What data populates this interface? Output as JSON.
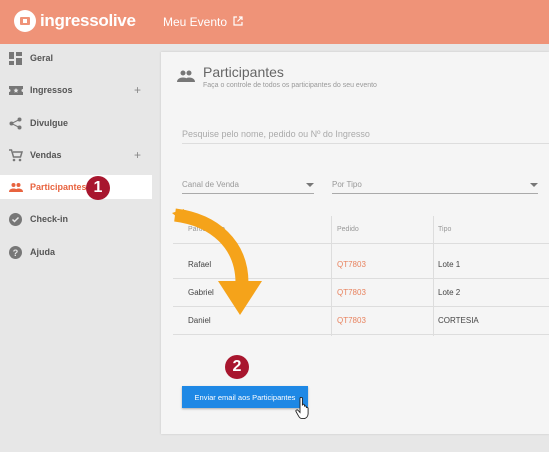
{
  "header": {
    "brand": "ingressolive",
    "event_link": "Meu Evento",
    "bg_color": "#ef9378"
  },
  "sidebar": {
    "items": [
      {
        "label": "Geral",
        "icon": "dashboard-icon",
        "expandable": false
      },
      {
        "label": "Ingressos",
        "icon": "ticket-icon",
        "expandable": true
      },
      {
        "label": "Divulgue",
        "icon": "share-icon",
        "expandable": false
      },
      {
        "label": "Vendas",
        "icon": "cart-icon",
        "expandable": true
      },
      {
        "label": "Participantes",
        "icon": "people-icon",
        "active": true
      },
      {
        "label": "Check-in",
        "icon": "check-circle-icon",
        "expandable": false
      },
      {
        "label": "Ajuda",
        "icon": "help-icon",
        "expandable": false
      }
    ],
    "plus": "+"
  },
  "annotations": {
    "step1": "1",
    "step2": "2",
    "badge_color": "#a8162e",
    "arrow_color": "#f5a31a"
  },
  "main": {
    "title": "Participantes",
    "subtitle": "Faça o controle de todos os participantes do seu evento",
    "search_placeholder": "Pesquise pelo nome, pedido ou Nº do Ingresso",
    "filter_channel": "Canal de Venda",
    "filter_type": "Por Tipo",
    "table": {
      "headers": [
        "Participante",
        "Pedido",
        "Tipo"
      ],
      "rows": [
        [
          "Rafael",
          "QT7803",
          "Lote 1"
        ],
        [
          "Gabriel",
          "QT7803",
          "Lote 2"
        ],
        [
          "Daniel",
          "QT7803",
          "CORTESIA"
        ]
      ]
    },
    "email_button": "Enviar email aos Participantes",
    "accent_color": "#e8633f",
    "button_color": "#1e88e5"
  }
}
